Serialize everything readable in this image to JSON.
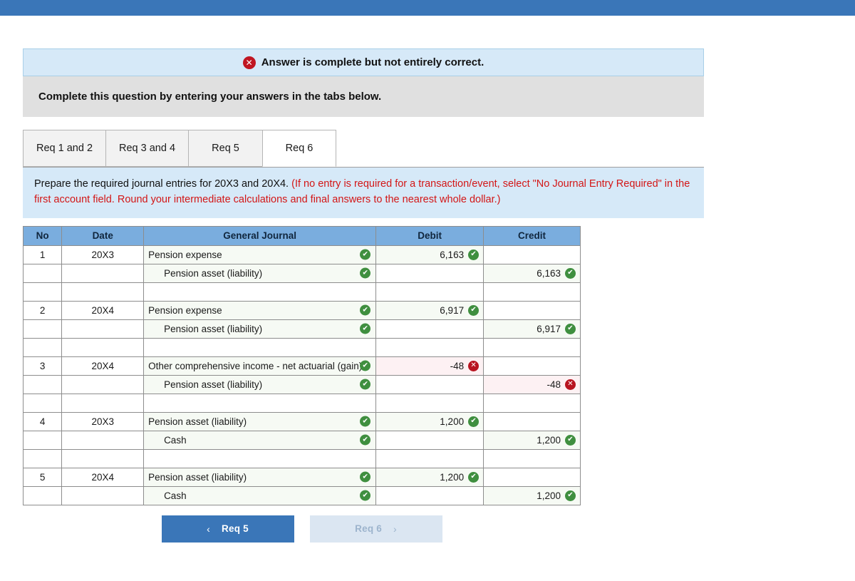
{
  "status_banner": {
    "icon": "x-circle-icon",
    "text": "Answer is complete but not entirely correct."
  },
  "complete_bar": {
    "text": "Complete this question by entering your answers in the tabs below."
  },
  "tabs": [
    {
      "label": "Req 1 and 2",
      "active": false
    },
    {
      "label": "Req 3 and 4",
      "active": false
    },
    {
      "label": "Req 5",
      "active": false
    },
    {
      "label": "Req 6",
      "active": true
    }
  ],
  "prompt": {
    "black": "Prepare the required journal entries for 20X3 and 20X4.",
    "red": "(If no entry is required for a transaction/event, select \"No Journal Entry Required\" in the first account field. Round your intermediate calculations and final answers to the nearest whole dollar.)"
  },
  "table": {
    "headers": [
      "No",
      "Date",
      "General Journal",
      "Debit",
      "Credit"
    ],
    "rows": [
      {
        "no": "1",
        "date": "20X3",
        "account": "Pension expense",
        "indent": false,
        "account_mark": "ok",
        "debit": "6,163",
        "debit_mark": "ok",
        "credit": "",
        "credit_mark": ""
      },
      {
        "no": "",
        "date": "",
        "account": "Pension asset (liability)",
        "indent": true,
        "account_mark": "ok",
        "debit": "",
        "debit_mark": "",
        "credit": "6,163",
        "credit_mark": "ok"
      },
      {
        "spacer": true
      },
      {
        "no": "2",
        "date": "20X4",
        "account": "Pension expense",
        "indent": false,
        "account_mark": "ok",
        "debit": "6,917",
        "debit_mark": "ok",
        "credit": "",
        "credit_mark": ""
      },
      {
        "no": "",
        "date": "",
        "account": "Pension asset (liability)",
        "indent": true,
        "account_mark": "ok",
        "debit": "",
        "debit_mark": "",
        "credit": "6,917",
        "credit_mark": "ok"
      },
      {
        "spacer": true
      },
      {
        "no": "3",
        "date": "20X4",
        "account": "Other comprehensive income - net actuarial (gain)",
        "indent": false,
        "account_mark": "ok",
        "debit": "-48",
        "debit_mark": "bad",
        "credit": "",
        "credit_mark": ""
      },
      {
        "no": "",
        "date": "",
        "account": "Pension asset (liability)",
        "indent": true,
        "account_mark": "ok",
        "debit": "",
        "debit_mark": "",
        "credit": "-48",
        "credit_mark": "bad"
      },
      {
        "spacer": true
      },
      {
        "no": "4",
        "date": "20X3",
        "account": "Pension asset (liability)",
        "indent": false,
        "account_mark": "ok",
        "debit": "1,200",
        "debit_mark": "ok",
        "credit": "",
        "credit_mark": ""
      },
      {
        "no": "",
        "date": "",
        "account": "Cash",
        "indent": true,
        "account_mark": "ok",
        "debit": "",
        "debit_mark": "",
        "credit": "1,200",
        "credit_mark": "ok"
      },
      {
        "spacer": true
      },
      {
        "no": "5",
        "date": "20X4",
        "account": "Pension asset (liability)",
        "indent": false,
        "account_mark": "ok",
        "debit": "1,200",
        "debit_mark": "ok",
        "credit": "",
        "credit_mark": ""
      },
      {
        "no": "",
        "date": "",
        "account": "Cash",
        "indent": true,
        "account_mark": "ok",
        "debit": "",
        "debit_mark": "",
        "credit": "1,200",
        "credit_mark": "ok"
      }
    ]
  },
  "nav": {
    "prev": {
      "label": "Req 5",
      "chevron": "‹",
      "state": "enabled"
    },
    "next": {
      "label": "Req 6",
      "chevron": "›",
      "state": "disabled"
    }
  },
  "glyphs": {
    "check": "✔",
    "cross": "✕"
  },
  "colors": {
    "topbar": "#3a76b8",
    "banner": "#d6e9f8",
    "grey_bar": "#e0e0e0",
    "table_header": "#7aadde",
    "correct": "#3f8f3f",
    "incorrect": "#b81420",
    "red_text": "#d31616"
  }
}
